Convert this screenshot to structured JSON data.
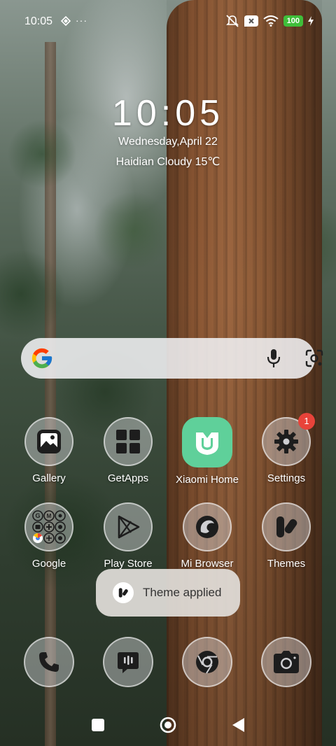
{
  "status_bar": {
    "time": "10:05",
    "overflow": "···",
    "battery": "100",
    "icons": [
      "diamond-icon",
      "notifications-muted-icon",
      "sim-x-icon",
      "wifi-icon",
      "battery-icon",
      "charging-icon"
    ]
  },
  "clock_widget": {
    "time": "10:05",
    "date": "Wednesday,April 22",
    "weather": "Haidian Cloudy 15℃"
  },
  "search_bar": {
    "icons": [
      "google-logo-icon",
      "microphone-icon",
      "lens-icon"
    ]
  },
  "apps_row1": [
    {
      "label": "Gallery",
      "icon": "gallery-icon"
    },
    {
      "label": "GetApps",
      "icon": "getapps-grid-icon"
    },
    {
      "label": "Xiaomi Home",
      "icon": "xiaomi-home-icon"
    },
    {
      "label": "Settings",
      "icon": "gear-icon",
      "badge": "1"
    }
  ],
  "apps_row2": [
    {
      "label": "Google",
      "icon": "google-folder-icon"
    },
    {
      "label": "Play Store",
      "icon": "play-store-icon"
    },
    {
      "label": "Mi Browser",
      "icon": "mi-browser-icon"
    },
    {
      "label": "Themes",
      "icon": "themes-icon"
    }
  ],
  "toast": {
    "text": "Theme applied",
    "icon": "themes-icon"
  },
  "dock": [
    {
      "icon": "phone-icon"
    },
    {
      "icon": "messages-icon"
    },
    {
      "icon": "chrome-icon"
    },
    {
      "icon": "camera-icon"
    }
  ],
  "nav_bar": {
    "icons": [
      "recents-icon",
      "home-icon",
      "back-icon"
    ]
  }
}
